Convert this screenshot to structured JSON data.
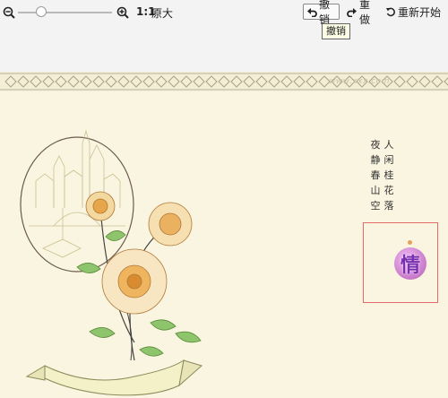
{
  "toolbar": {
    "zoom_ratio": "1:1",
    "zoom_label": "原大",
    "zoom_level": 0.25,
    "undo_label": "撤销",
    "redo_label": "重做",
    "restart_label": "重新开始"
  },
  "tooltip": {
    "text": "撤销"
  },
  "canvas": {
    "watermark": "www.xxx.com",
    "poem": {
      "column_1": "人闲桂花落",
      "column_2": "夜静春山空"
    },
    "stamp_char": "情",
    "colors": {
      "background": "#faf5e0",
      "selection_border": "#e36a6a",
      "stamp": "#c77ac9"
    }
  }
}
